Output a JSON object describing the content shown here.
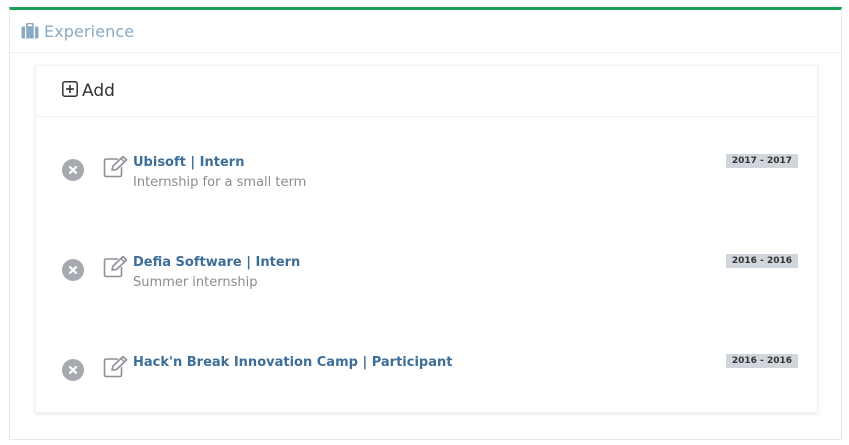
{
  "panel": {
    "title": "Experience",
    "accent_color": "#1ba05a",
    "icon": "briefcase-icon"
  },
  "add": {
    "label": "Add",
    "icon": "plus-square-icon"
  },
  "entries": [
    {
      "title": "Ubisoft | Intern",
      "description": "Internship for a small term",
      "dates": "2017 - 2017"
    },
    {
      "title": "Defia Software | Intern",
      "description": "Summer internship",
      "dates": "2016 - 2016"
    },
    {
      "title": "Hack'n Break Innovation Camp | Participant",
      "description": "",
      "dates": "2016 - 2016"
    }
  ]
}
